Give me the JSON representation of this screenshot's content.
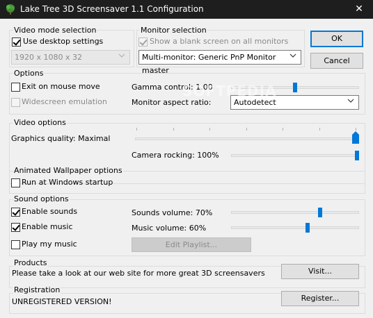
{
  "window": {
    "title": "Lake Tree 3D Screensaver 1.1 Configuration",
    "close_glyph": "✕"
  },
  "video_mode": {
    "group_label": "Video mode selection",
    "use_desktop_label": "Use desktop settings",
    "use_desktop_checked": true,
    "resolution_value": "1920 x 1080 x 32"
  },
  "monitor": {
    "group_label": "Monitor selection",
    "blank_label": "Show a blank screen on all monitors",
    "blank_checked": true,
    "monitor_value": "Multi-monitor: Generic PnP Monitor master"
  },
  "buttons": {
    "ok": "OK",
    "cancel": "Cancel"
  },
  "options": {
    "group_label": "Options",
    "exit_mouse_label": "Exit on mouse move",
    "exit_mouse_checked": false,
    "widescreen_label": "Widescreen emulation",
    "widescreen_checked": false,
    "gamma_label": "Gamma control: 1.00",
    "gamma_level": 0.5,
    "aspect_label": "Monitor aspect ratio:",
    "aspect_value": "Autodetect"
  },
  "video_options": {
    "group_label": "Video options",
    "quality_label": "Graphics quality: Maximal",
    "quality_level": 1.0,
    "rocking_label": "Camera rocking: 100%",
    "rocking_level": 1.0
  },
  "wallpaper": {
    "group_label": "Animated Wallpaper options",
    "startup_label": "Run at Windows startup",
    "startup_checked": false
  },
  "sound": {
    "group_label": "Sound options",
    "enable_sounds_label": "Enable sounds",
    "enable_sounds_checked": true,
    "enable_music_label": "Enable music",
    "enable_music_checked": true,
    "play_music_label": "Play my music",
    "play_music_checked": false,
    "sounds_volume_label": "Sounds volume: 70%",
    "sounds_volume_level": 0.7,
    "music_volume_label": "Music volume: 60%",
    "music_volume_level": 0.6,
    "edit_playlist_label": "Edit Playlist..."
  },
  "products": {
    "group_label": "Products",
    "text": "Please take a look at our web site for more great 3D screensavers",
    "visit_label": "Visit..."
  },
  "registration": {
    "group_label": "Registration",
    "status": "UNREGISTERED VERSION!",
    "register_label": "Register..."
  },
  "watermark": "SOFTPEDIA"
}
